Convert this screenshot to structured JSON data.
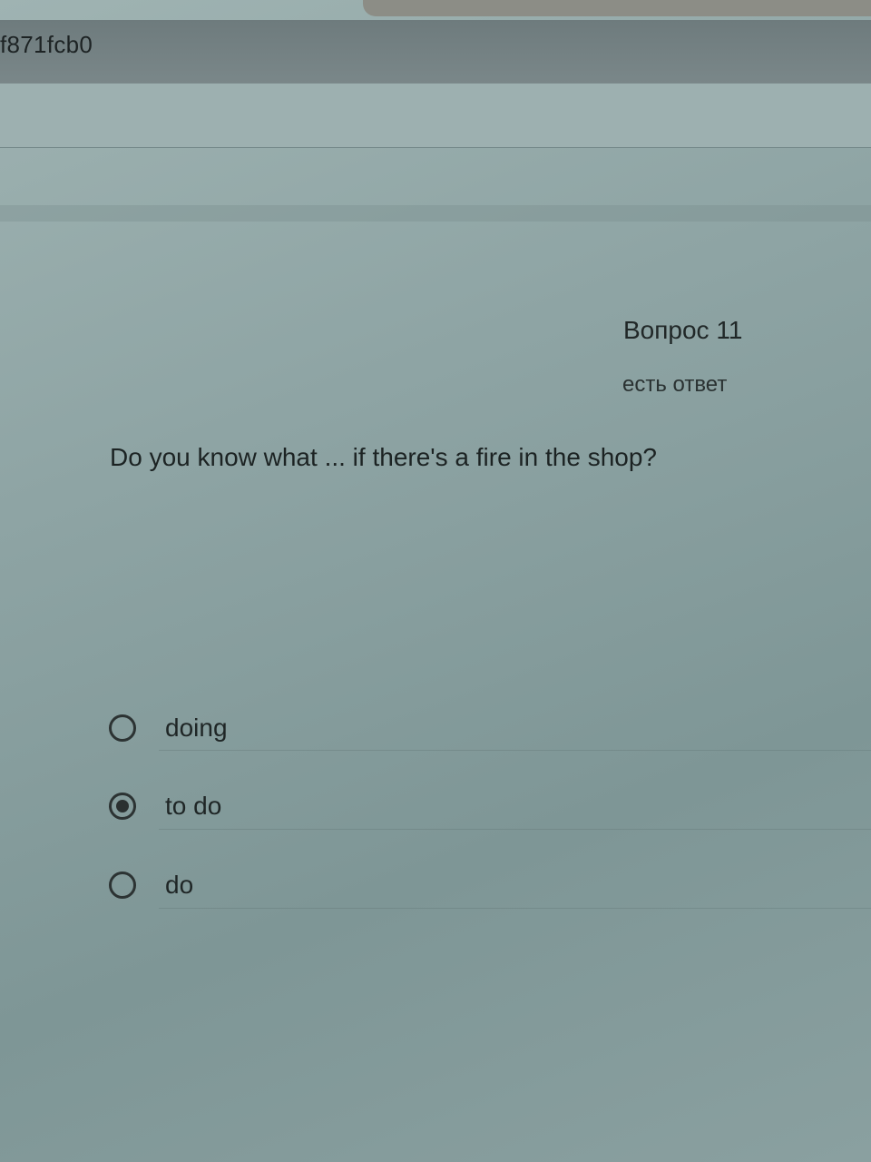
{
  "browser": {
    "url_fragment": "f871fcb0"
  },
  "question": {
    "label": "Вопрос 11",
    "status": "есть ответ",
    "text": "Do you know what ... if there's a fire in the shop?",
    "options": [
      {
        "label": "doing",
        "selected": false
      },
      {
        "label": "to do",
        "selected": true
      },
      {
        "label": "do",
        "selected": false
      }
    ]
  }
}
